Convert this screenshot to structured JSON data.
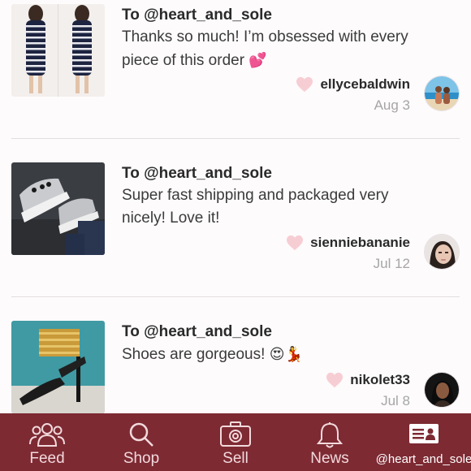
{
  "reviews": [
    {
      "to": "To @heart_and_sole",
      "message_lines": [
        "Thanks so much! I’m obsessed with every",
        "piece of this order"
      ],
      "emoji": "💕",
      "username": "ellycebaldwin",
      "date": "Aug 3",
      "thumb_icon": "striped-dress-photo",
      "avatar_icon": "couple-beach-avatar"
    },
    {
      "to": "To @heart_and_sole",
      "message_lines": [
        "Super fast shipping and packaged very",
        "nicely! Love it!"
      ],
      "emoji": "",
      "username": "sienniebananie",
      "date": "Jul 12",
      "thumb_icon": "sneakers-photo",
      "avatar_icon": "woman-selfie-avatar"
    },
    {
      "to": "To @heart_and_sole",
      "message_lines": [
        "Shoes are gorgeous!"
      ],
      "emoji": "😍💃",
      "username": "nikolet33",
      "date": "Jul 8",
      "thumb_icon": "heels-photo",
      "avatar_icon": "woman-dark-avatar"
    }
  ],
  "tabbar": {
    "background": "#7d2a33",
    "tabs": [
      {
        "label": "Feed",
        "icon": "people-icon"
      },
      {
        "label": "Shop",
        "icon": "search-icon"
      },
      {
        "label": "Sell",
        "icon": "camera-icon"
      },
      {
        "label": "News",
        "icon": "bell-icon"
      },
      {
        "label": "@heart_and_sole",
        "icon": "profile-card-icon"
      }
    ]
  }
}
